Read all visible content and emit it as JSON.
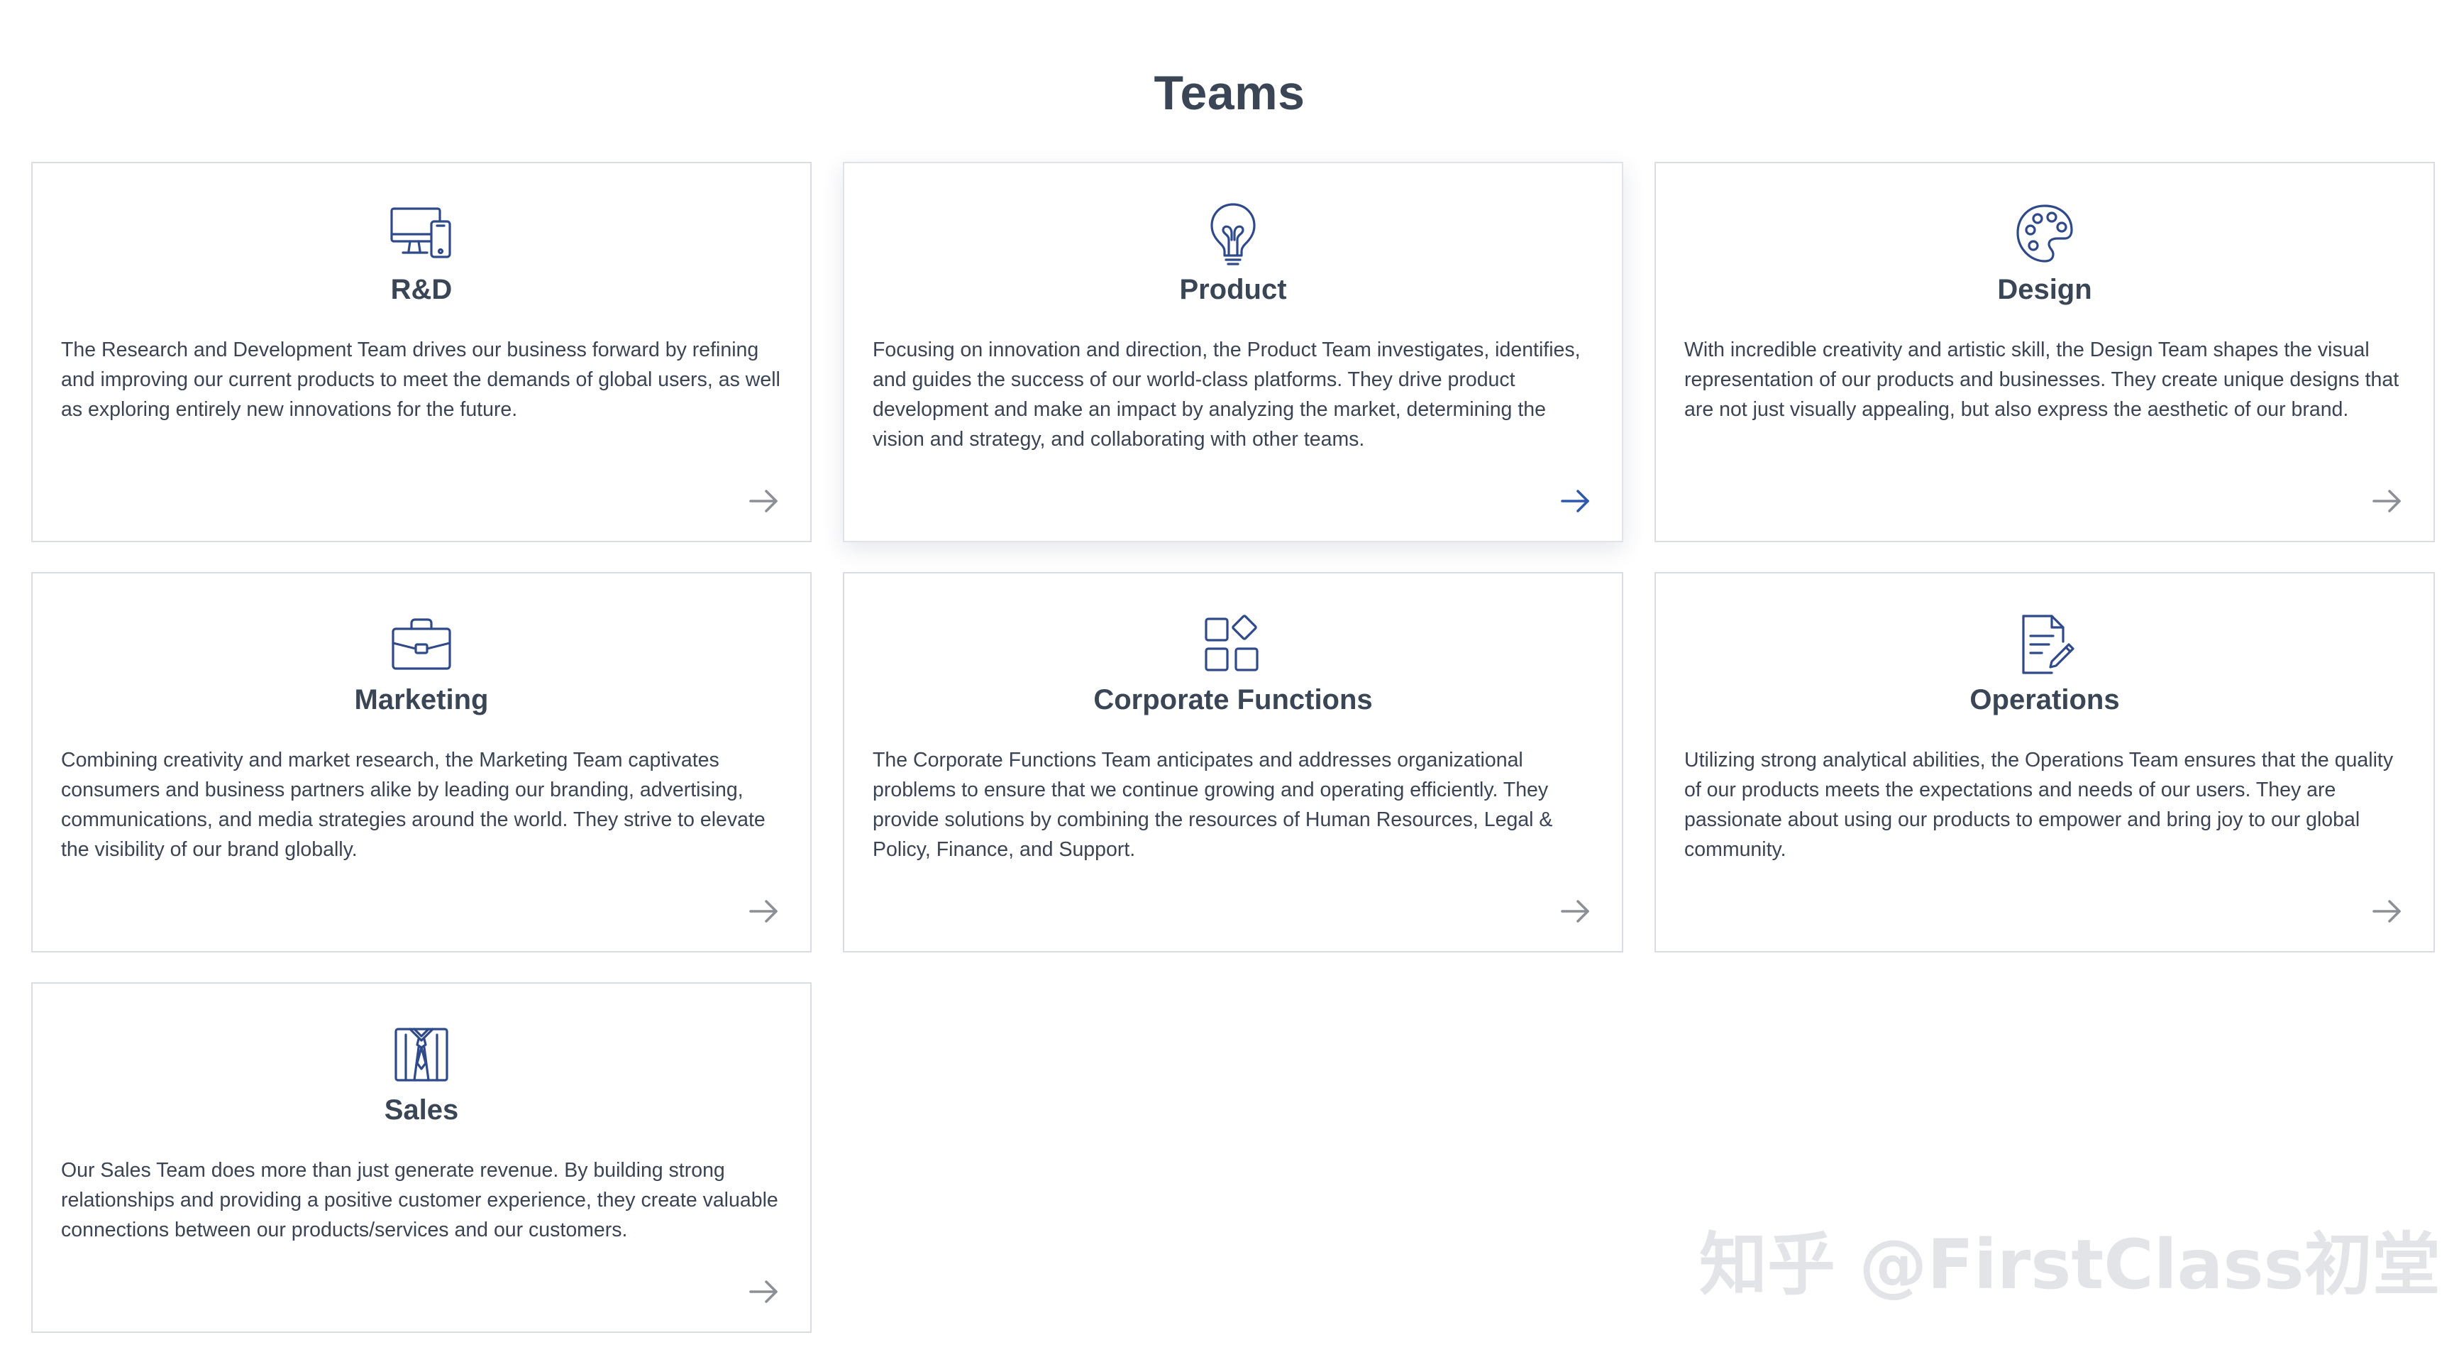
{
  "page": {
    "title": "Teams"
  },
  "colors": {
    "icon": "#2f4a8a",
    "arrow_default": "#8c8f96",
    "arrow_active": "#2f57b0",
    "card_border": "#d9dde3",
    "text": "#3b4455"
  },
  "teams": [
    {
      "title": "R&D",
      "icon": "devices-icon",
      "description": "The Research and Development Team drives our business forward by refining and improving our current products to meet the demands of global users, as well as exploring entirely new innovations for the future.",
      "active": false
    },
    {
      "title": "Product",
      "icon": "lightbulb-icon",
      "description": "Focusing on innovation and direction, the Product Team investigates, identifies, and guides the success of our world-class platforms. They drive product development and make an impact by analyzing the market, determining the vision and strategy, and collaborating with other teams.",
      "active": true
    },
    {
      "title": "Design",
      "icon": "palette-icon",
      "description": "With incredible creativity and artistic skill, the Design Team shapes the visual representation of our products and businesses. They create unique designs that are not just visually appealing, but also express the aesthetic of our brand.",
      "active": false
    },
    {
      "title": "Marketing",
      "icon": "briefcase-icon",
      "description": "Combining creativity and market research, the Marketing Team captivates consumers and business partners alike by leading our branding, advertising, communications, and media strategies around the world. They strive to elevate the visibility of our brand globally.",
      "active": false
    },
    {
      "title": "Corporate Functions",
      "icon": "grid-apps-icon",
      "description": "The Corporate Functions Team anticipates and addresses organizational problems to ensure that we continue growing and operating efficiently. They provide solutions by combining the resources of Human Resources, Legal & Policy, Finance, and Support.",
      "active": false
    },
    {
      "title": "Operations",
      "icon": "document-edit-icon",
      "description": "Utilizing strong analytical abilities, the Operations Team ensures that the quality of our products meets the expectations and needs of our users. They are passionate about using our products to empower and bring joy to our global community.",
      "active": false
    },
    {
      "title": "Sales",
      "icon": "suit-tie-icon",
      "description": "Our Sales Team does more than just generate revenue. By building strong relationships and providing a positive customer experience, they create valuable connections between our products/services and our customers.",
      "active": false
    }
  ],
  "watermark": {
    "text": "知乎 @FirstClass初堂"
  }
}
